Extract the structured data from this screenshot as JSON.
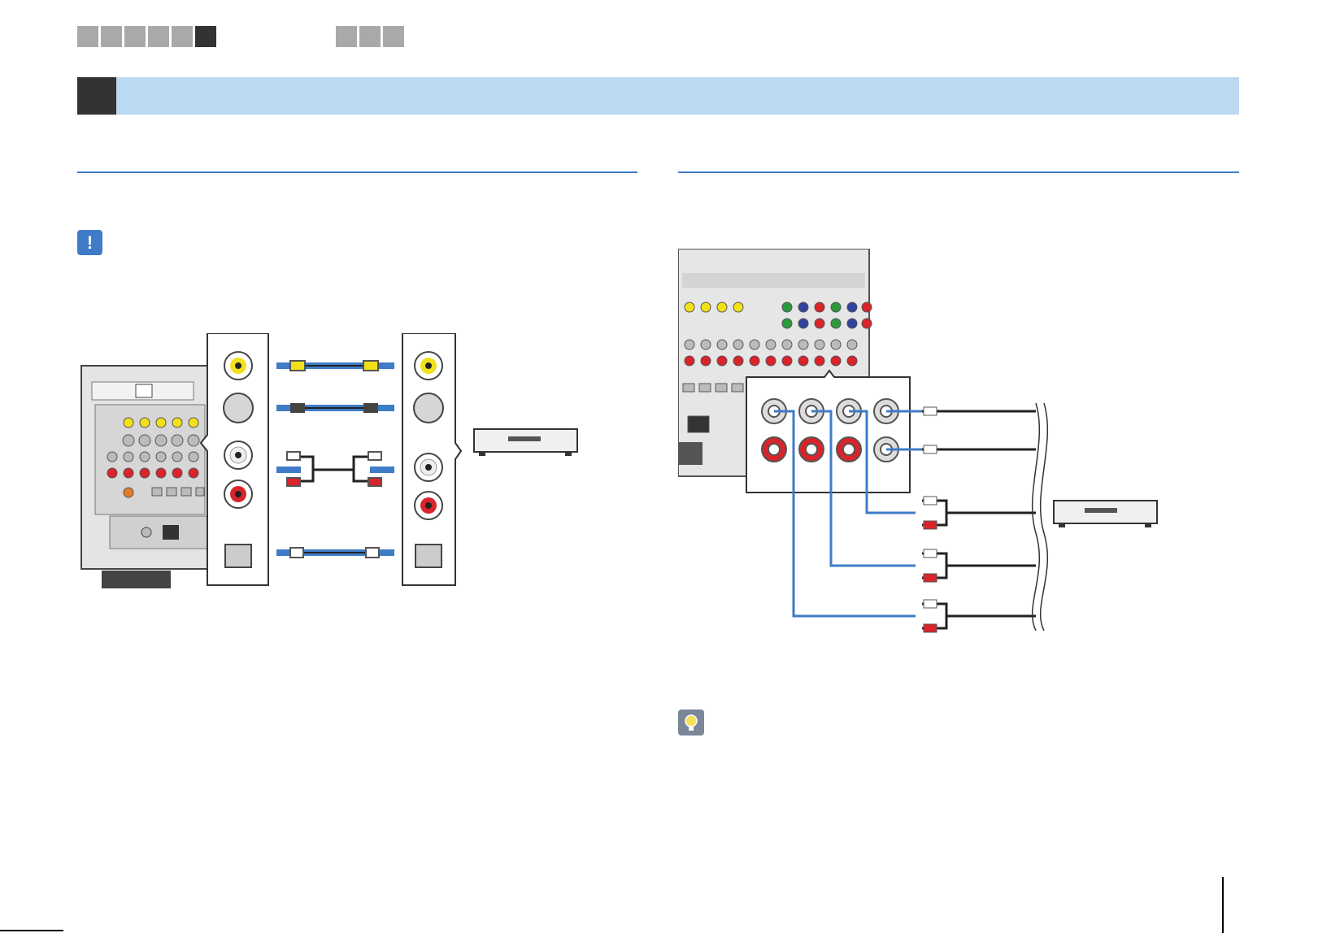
{
  "nav": {
    "group1": [
      "",
      "",
      "",
      "",
      "",
      ""
    ],
    "group1_active_index": 5,
    "group2": [
      "",
      "",
      ""
    ]
  },
  "section": {
    "number": "",
    "title": ""
  },
  "left": {
    "heading": "",
    "notice_icon": "exclamation-icon"
  },
  "right": {
    "heading": "",
    "tip_icon": "lightbulb-icon"
  },
  "colors": {
    "accent": "#3f7cc7",
    "section_bar": "#bcd9f2",
    "nav_tab": "#a9a9a9",
    "nav_tab_active": "#333333",
    "yellow_plug": "#f2e11a",
    "red_plug": "#d8242a"
  }
}
